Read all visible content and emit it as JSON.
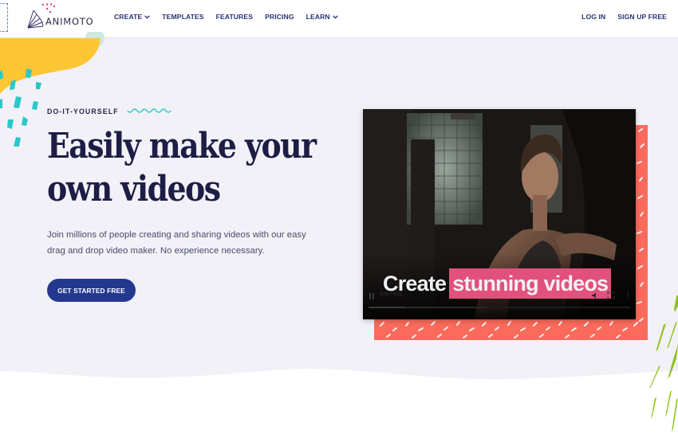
{
  "brand": {
    "name": "ANIMOTO",
    "colors": {
      "navy": "#24388e",
      "heading": "#1c1e45",
      "coral": "#fa6b5c",
      "pink_highlight": "#e2507d",
      "teal": "#2bc8c8",
      "yellow": "#fcc634",
      "green": "#8cc21a",
      "hero_bg": "#f2f1f8"
    }
  },
  "nav": {
    "items": [
      {
        "label": "CREATE",
        "icon": "chevron-down-icon"
      },
      {
        "label": "TEMPLATES"
      },
      {
        "label": "FEATURES"
      },
      {
        "label": "PRICING"
      },
      {
        "label": "LEARN",
        "icon": "chevron-down-icon"
      }
    ],
    "login": "LOG IN",
    "signup": "SIGN UP FREE"
  },
  "hero": {
    "eyebrow": "DO-IT-YOURSELF",
    "headline_line1": "Easily make your",
    "headline_line2": "own videos",
    "subtext": "Join millions of people creating and sharing videos with our easy drag and drop video maker. No experience necessary.",
    "cta": "GET STARTED FREE"
  },
  "video": {
    "caption_plain": "Create",
    "caption_highlight": "stunning videos",
    "time": "0:03 / 0:22",
    "progress": 0.14,
    "buffered": 0.45,
    "controls": [
      "pause-icon",
      "volume-icon",
      "fullscreen-icon",
      "more-options-icon"
    ]
  }
}
